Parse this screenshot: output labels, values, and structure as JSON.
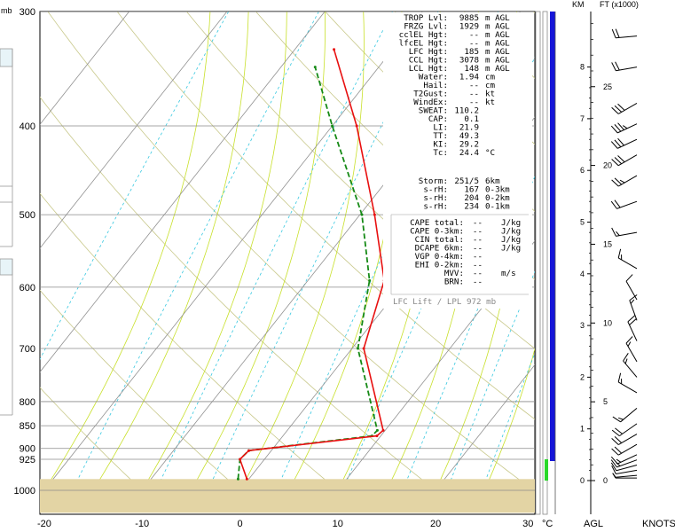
{
  "chart_data": {
    "type": "skew-t",
    "pressure_unit_label": "mb",
    "pressure_levels": [
      300,
      400,
      500,
      600,
      700,
      800,
      850,
      900,
      925,
      1000
    ],
    "temperature_ticks": [
      -20,
      -10,
      0,
      10,
      20,
      30
    ],
    "temperature_unit": "°C",
    "xlim": [
      -20,
      30
    ],
    "plim": [
      300,
      1000
    ],
    "temperature_profile": [
      {
        "p": 972,
        "t": -0.2
      },
      {
        "p": 925,
        "t": -2.5
      },
      {
        "p": 905,
        "t": -2.3
      },
      {
        "p": 872,
        "t": 9.6
      },
      {
        "p": 860,
        "t": 9.8
      },
      {
        "p": 700,
        "t": 1.2
      },
      {
        "p": 590,
        "t": -2.2
      },
      {
        "p": 500,
        "t": -8.5
      },
      {
        "p": 400,
        "t": -17.5
      },
      {
        "p": 330,
        "t": -26.0
      }
    ],
    "parcel_profile": [
      {
        "p": 972,
        "t": -1.1
      },
      {
        "p": 925,
        "t": -2.5
      },
      {
        "p": 905,
        "t": -2.3
      },
      {
        "p": 872,
        "t": 9.1
      },
      {
        "p": 860,
        "t": 9.2
      },
      {
        "p": 700,
        "t": 0.6
      },
      {
        "p": 590,
        "t": -3.7
      },
      {
        "p": 500,
        "t": -9.8
      },
      {
        "p": 400,
        "t": -20.0
      },
      {
        "p": 345,
        "t": -26.5
      }
    ],
    "height_axis": {
      "km_label": "KM",
      "ft_label": "FT (x1000)",
      "agl_label": "AGL",
      "knots_label": "KNOTS",
      "km_ticks": [
        0,
        1,
        2,
        3,
        4,
        5,
        6,
        7,
        8
      ],
      "ft_ticks": [
        0,
        5,
        10,
        15,
        20,
        25
      ]
    },
    "wind_barbs": [
      {
        "km": 0.05,
        "dir": 270,
        "spd": 5
      },
      {
        "km": 0.1,
        "dir": 265,
        "spd": 5
      },
      {
        "km": 0.2,
        "dir": 260,
        "spd": 10
      },
      {
        "km": 0.3,
        "dir": 255,
        "spd": 10
      },
      {
        "km": 0.4,
        "dir": 250,
        "spd": 15
      },
      {
        "km": 0.5,
        "dir": 245,
        "spd": 15
      },
      {
        "km": 0.7,
        "dir": 240,
        "spd": 20
      },
      {
        "km": 0.9,
        "dir": 240,
        "spd": 20
      },
      {
        "km": 1.1,
        "dir": 235,
        "spd": 20
      },
      {
        "km": 1.4,
        "dir": 230,
        "spd": 15
      },
      {
        "km": 1.7,
        "dir": 300,
        "spd": 15
      },
      {
        "km": 2.0,
        "dir": 320,
        "spd": 15
      },
      {
        "km": 2.3,
        "dir": 330,
        "spd": 15
      },
      {
        "km": 2.7,
        "dir": 335,
        "spd": 20
      },
      {
        "km": 3.1,
        "dir": 340,
        "spd": 15
      },
      {
        "km": 3.5,
        "dir": 330,
        "spd": 10
      },
      {
        "km": 4.1,
        "dir": 300,
        "spd": 15
      },
      {
        "km": 4.8,
        "dir": 260,
        "spd": 15
      },
      {
        "km": 5.4,
        "dir": 250,
        "spd": 20
      },
      {
        "km": 5.9,
        "dir": 240,
        "spd": 25
      },
      {
        "km": 6.3,
        "dir": 240,
        "spd": 30
      },
      {
        "km": 6.6,
        "dir": 245,
        "spd": 30
      },
      {
        "km": 6.9,
        "dir": 245,
        "spd": 35
      },
      {
        "km": 7.3,
        "dir": 240,
        "spd": 30
      },
      {
        "km": 8.0,
        "dir": 260,
        "spd": 20
      },
      {
        "km": 8.6,
        "dir": 265,
        "spd": 20
      }
    ]
  },
  "indices_top": [
    {
      "label": "TROP Lvl:",
      "value": "9885",
      "unit": "m AGL"
    },
    {
      "label": "FRZG Lvl:",
      "value": "1929",
      "unit": "m AGL"
    },
    {
      "label": "cclEL Hgt:",
      "value": "--",
      "unit": "m AGL"
    },
    {
      "label": "lfcEL Hgt:",
      "value": "--",
      "unit": "m AGL"
    },
    {
      "label": "LFC Hgt:",
      "value": "185",
      "unit": "m AGL"
    },
    {
      "label": "CCL Hgt:",
      "value": "3078",
      "unit": "m AGL"
    },
    {
      "label": "LCL Hgt:",
      "value": "148",
      "unit": "m AGL"
    },
    {
      "label": "Water:",
      "value": "1.94",
      "unit": "cm"
    },
    {
      "label": "Hail:",
      "value": "--",
      "unit": "cm"
    },
    {
      "label": "T2Gust:",
      "value": "--",
      "unit": "kt"
    },
    {
      "label": "WindEx:",
      "value": "--",
      "unit": "kt"
    },
    {
      "label": "SWEAT:",
      "value": "110.2",
      "unit": ""
    },
    {
      "label": "CAP:",
      "value": "0.1",
      "unit": ""
    },
    {
      "label": "LI:",
      "value": "21.9",
      "unit": ""
    },
    {
      "label": "TT:",
      "value": "49.3",
      "unit": ""
    },
    {
      "label": "KI:",
      "value": "29.2",
      "unit": ""
    },
    {
      "label": "Tc:",
      "value": "24.4",
      "unit": "°C"
    }
  ],
  "storm": [
    {
      "label": "Storm:",
      "value": "251/5",
      "unit": "6km"
    },
    {
      "label": "s-rH:",
      "value": "167",
      "unit": "0-3km"
    },
    {
      "label": "s-rH:",
      "value": "204",
      "unit": "0-2km"
    },
    {
      "label": "s-rH:",
      "value": "234",
      "unit": "0-1km"
    }
  ],
  "cape_block": [
    {
      "label": "CAPE total:",
      "value": "--",
      "unit": "J/kg"
    },
    {
      "label": "CAPE 0-3km:",
      "value": "--",
      "unit": "J/kg"
    },
    {
      "label": "CIN total:",
      "value": "--",
      "unit": "J/kg"
    },
    {
      "label": "DCAPE 6km:",
      "value": "--",
      "unit": "J/kg"
    },
    {
      "label": "VGP 0-4km:",
      "value": "--",
      "unit": ""
    },
    {
      "label": "EHI 0-2km:",
      "value": "--",
      "unit": ""
    },
    {
      "label": "MVV:",
      "value": "--",
      "unit": "m/s"
    },
    {
      "label": "BRN:",
      "value": "--",
      "unit": ""
    }
  ],
  "lift_label": "LFC Lift / LPL 972 mb",
  "colors": {
    "temperature": "#e81010",
    "parcel": "#168a16",
    "isotherm": "#909090",
    "dry_adiabat": "#c8c88a",
    "moist_adiabat": "#c8e02a",
    "mixing_ratio": "#36c8e0",
    "ground": "#e3d4a4",
    "column_blue": "#1515d8",
    "column_green": "#28d828"
  }
}
